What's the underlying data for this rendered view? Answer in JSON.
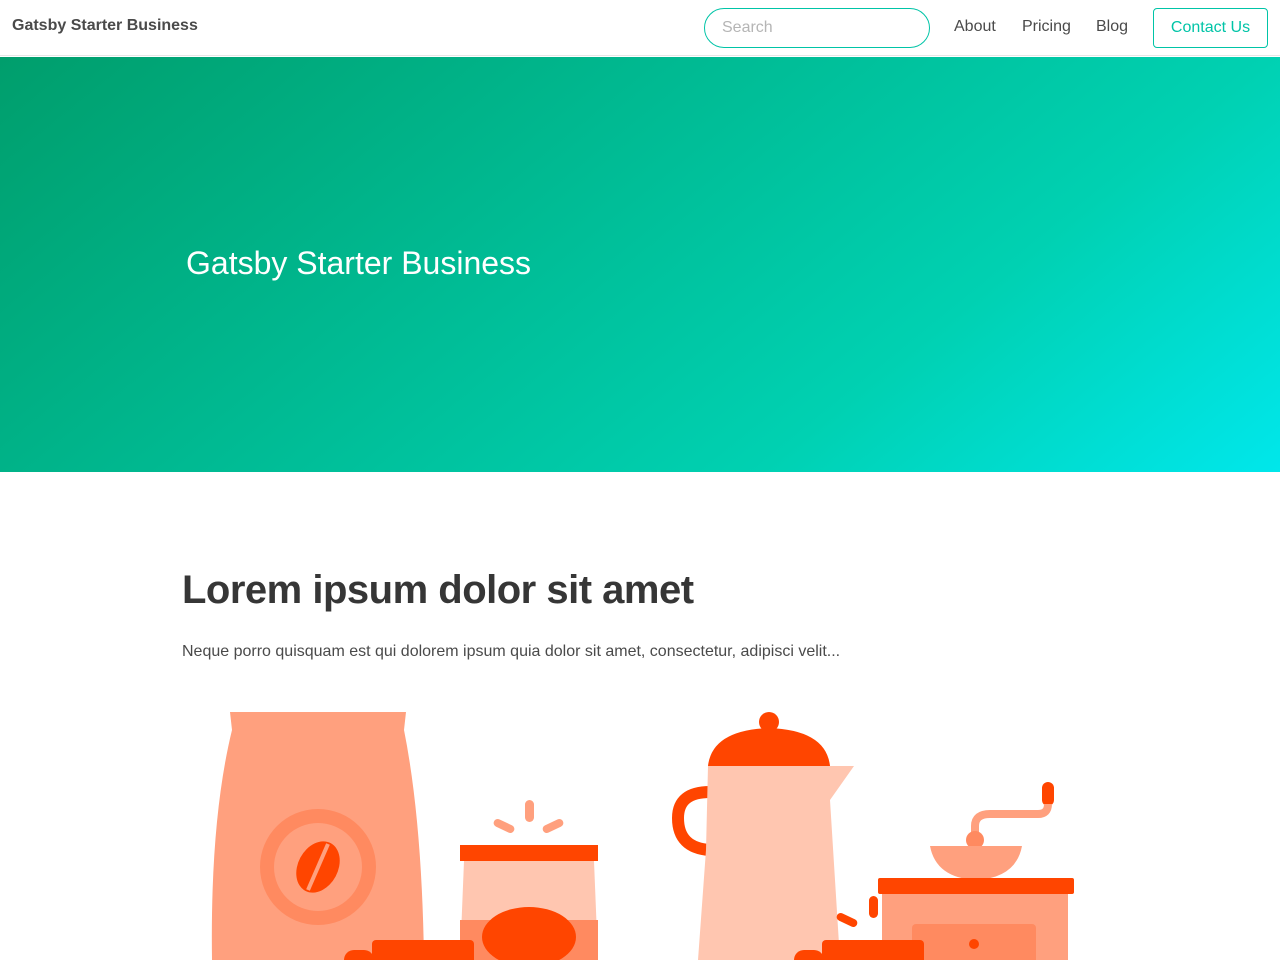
{
  "navbar": {
    "brand": "Gatsby Starter Business",
    "search": {
      "placeholder": "Search",
      "value": ""
    },
    "links": [
      {
        "label": "About"
      },
      {
        "label": "Pricing"
      },
      {
        "label": "Blog"
      }
    ],
    "contact_button": "Contact Us"
  },
  "hero": {
    "title": "Gatsby Starter Business"
  },
  "section": {
    "heading": "Lorem ipsum dolor sit amet",
    "description": "Neque porro quisquam est qui dolorem ipsum quia dolor sit amet, consectetur, adipisci velit..."
  },
  "illustrations": [
    {
      "icon": "coffee-bag-and-jar-illustration"
    },
    {
      "icon": "coffee-pot-and-grinder-illustration"
    }
  ],
  "colors": {
    "accent": "#00c4a7",
    "hero_gradient_start": "#009e6c",
    "hero_gradient_mid": "#00d1b2",
    "hero_gradient_end": "#00e7eb",
    "illustration_dark": "#ff4500",
    "illustration_mid": "#ffa07e",
    "illustration_light": "#ffc6b0"
  }
}
